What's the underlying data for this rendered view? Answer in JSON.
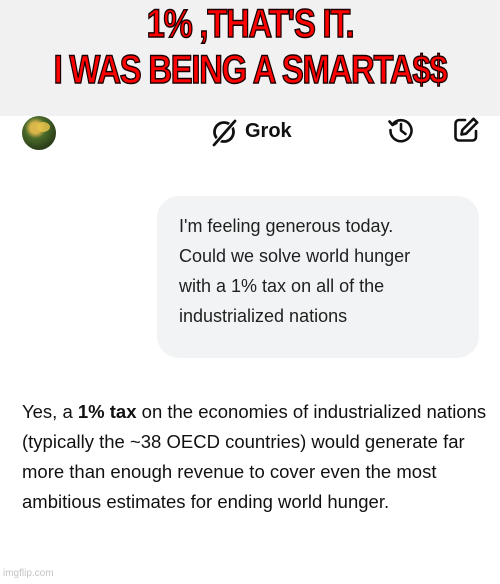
{
  "meme": {
    "caption_line1": "1% ,THAT'S IT.",
    "caption_line2": "I WAS BEING A SMARTA$$"
  },
  "header": {
    "app_name": "Grok",
    "icons": [
      "avatar",
      "grok-logo-icon",
      "history-icon",
      "compose-icon"
    ]
  },
  "chat": {
    "user_message": "I'm feeling generous today.\nCould we solve world hunger\nwith a 1% tax on all of the\nindustrialized nations",
    "reply_prefix": "Yes, a ",
    "reply_bold": "1% tax",
    "reply_rest": " on the economies of industrialized nations (typically the ~38 OECD countries) would generate far more than enough revenue to cover even the most ambitious estimates for ending world hunger."
  },
  "watermark": "imgflip.com",
  "colors": {
    "caption": "#ff0000",
    "caption_band": "#f1f1f1",
    "bubble": "#f2f3f4",
    "text": "#111111"
  }
}
